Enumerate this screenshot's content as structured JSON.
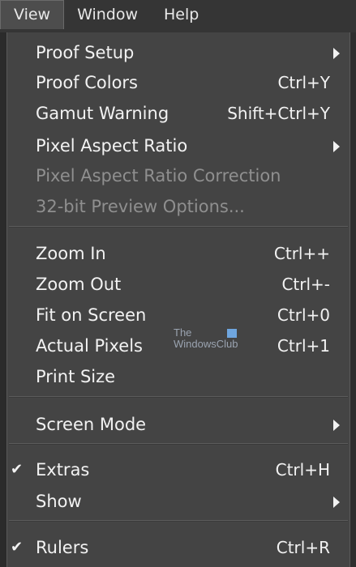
{
  "menubar": {
    "items": [
      {
        "label": "View"
      },
      {
        "label": "Window"
      },
      {
        "label": "Help"
      }
    ]
  },
  "menu": {
    "items": [
      {
        "label": "Proof Setup",
        "shortcut": "",
        "submenu": true,
        "checked": false,
        "disabled": false
      },
      {
        "label": "Proof Colors",
        "shortcut": "Ctrl+Y",
        "submenu": false,
        "checked": false,
        "disabled": false
      },
      {
        "label": "Gamut Warning",
        "shortcut": "Shift+Ctrl+Y",
        "submenu": false,
        "checked": false,
        "disabled": false
      },
      {
        "label": "Pixel Aspect Ratio",
        "shortcut": "",
        "submenu": true,
        "checked": false,
        "disabled": false
      },
      {
        "label": "Pixel Aspect Ratio Correction",
        "shortcut": "",
        "submenu": false,
        "checked": false,
        "disabled": true
      },
      {
        "label": "32-bit Preview Options...",
        "shortcut": "",
        "submenu": false,
        "checked": false,
        "disabled": true
      },
      {
        "label": "Zoom In",
        "shortcut": "Ctrl++",
        "submenu": false,
        "checked": false,
        "disabled": false
      },
      {
        "label": "Zoom Out",
        "shortcut": "Ctrl+-",
        "submenu": false,
        "checked": false,
        "disabled": false
      },
      {
        "label": "Fit on Screen",
        "shortcut": "Ctrl+0",
        "submenu": false,
        "checked": false,
        "disabled": false
      },
      {
        "label": "Actual Pixels",
        "shortcut": "Ctrl+1",
        "submenu": false,
        "checked": false,
        "disabled": false
      },
      {
        "label": "Print Size",
        "shortcut": "",
        "submenu": false,
        "checked": false,
        "disabled": false
      },
      {
        "label": "Screen Mode",
        "shortcut": "",
        "submenu": true,
        "checked": false,
        "disabled": false
      },
      {
        "label": "Extras",
        "shortcut": "Ctrl+H",
        "submenu": false,
        "checked": true,
        "disabled": false
      },
      {
        "label": "Show",
        "shortcut": "",
        "submenu": true,
        "checked": false,
        "disabled": false
      },
      {
        "label": "Rulers",
        "shortcut": "Ctrl+R",
        "submenu": false,
        "checked": true,
        "disabled": false
      }
    ],
    "check_glyph": "✔"
  },
  "watermark": {
    "line1": "The",
    "line2": "WindowsClub"
  },
  "colors": {
    "menu_bg": "#444444",
    "menubar_bg": "#353535",
    "text": "#f2f2f2",
    "disabled_text": "#8f8f8f"
  }
}
